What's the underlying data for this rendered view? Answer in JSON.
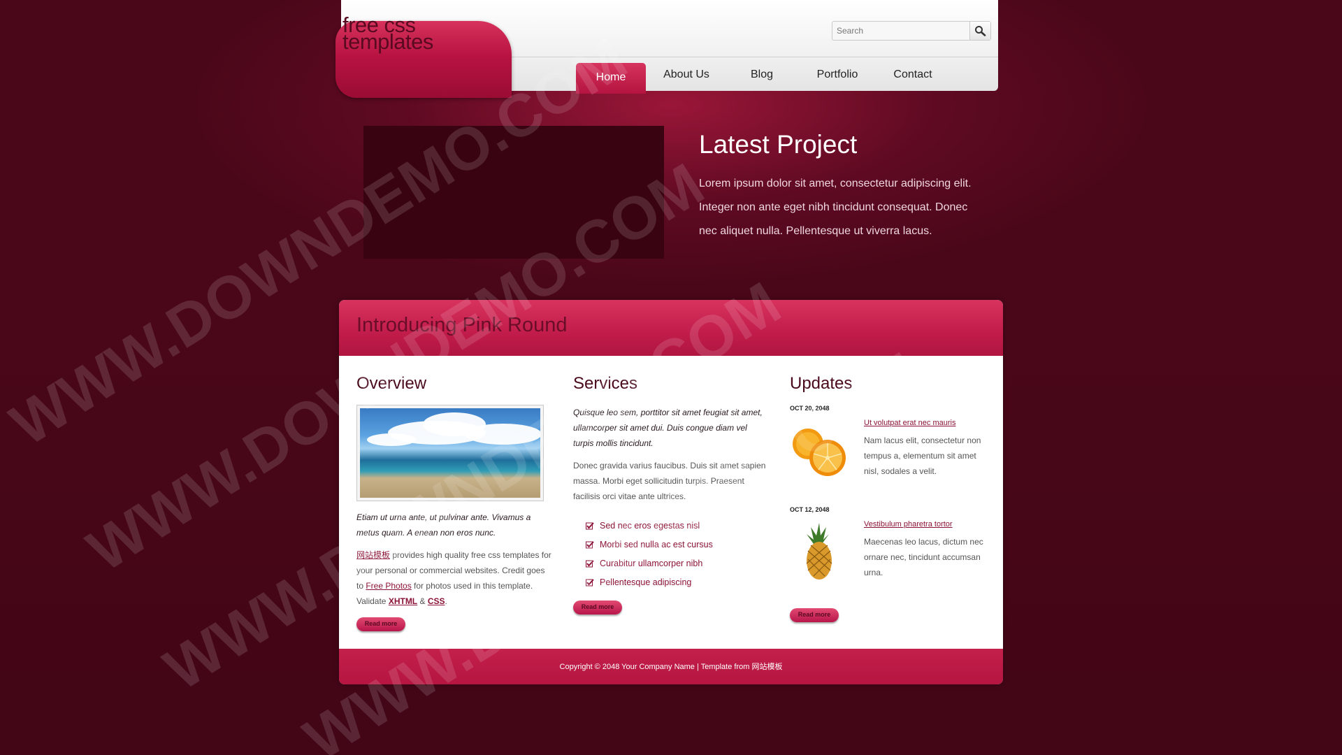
{
  "logo": {
    "text": "free css templates"
  },
  "search": {
    "placeholder": "Search"
  },
  "nav": {
    "items": [
      "Home",
      "About Us",
      "Blog",
      "Portfolio",
      "Contact"
    ],
    "active": "Home"
  },
  "project": {
    "title": "Latest Project",
    "text": "Lorem ipsum dolor sit amet, consectetur adipiscing elit. Integer non ante eget nibh tincidunt consequat. Donec nec aliquet nulla. Pellentesque ut viverra lacus."
  },
  "intro": {
    "title": "Introducing Pink Round"
  },
  "overview": {
    "title": "Overview",
    "italic": "Etiam ut urna ante, ut pulvinar ante. Vivamus a metus quam. A enean non eros nunc.",
    "link_site": "网站模板",
    "text_1": " provides high quality free css templates for your personal or commercial websites. Credit goes to ",
    "link_photos": "Free Photos",
    "text_2": " for photos used in this template. Validate ",
    "link_xhtml": "XHTML",
    "text_amp": " & ",
    "link_css": "CSS",
    "text_end": ".",
    "button": "Read more"
  },
  "services": {
    "title": "Services",
    "italic": "Quisque leo sem, porttitor sit amet feugiat sit amet, ullamcorper sit amet dui. Duis congue diam vel turpis mollis tincidunt.",
    "text": "Donec gravida varius faucibus. Duis sit amet sapien massa. Morbi eget sollicitudin turpis. Praesent facilisis orci vitae ante ultrices.",
    "items": [
      "Sed nec eros egestas nisl",
      "Morbi sed nulla ac est cursus",
      "Curabitur ullamcorper nibh",
      "Pellentesque adipiscing"
    ],
    "button": "Read more"
  },
  "updates": {
    "title": "Updates",
    "entries": [
      {
        "date": "OCT 20, 2048",
        "link": "Ut volutpat erat nec mauris",
        "text": "Nam lacus elit, consectetur non tempus a, elementum sit amet nisl, sodales a velit.",
        "image": "orange-image"
      },
      {
        "date": "OCT 12, 2048",
        "link": "Vestibulum pharetra tortor",
        "text": "Maecenas leo lacus, dictum nec ornare nec, tincidunt accumsan urna.",
        "image": "pineapple-image"
      }
    ],
    "button": "Read more"
  },
  "footer": {
    "copyright": "Copyright © 2048 Your Company Name | Template from 网站模板"
  },
  "watermark": {
    "text": "WWW.DOWNDEMO.COM"
  },
  "colors": {
    "accent": "#c11c4a",
    "background": "#5e0a22",
    "link": "#8b1236"
  }
}
